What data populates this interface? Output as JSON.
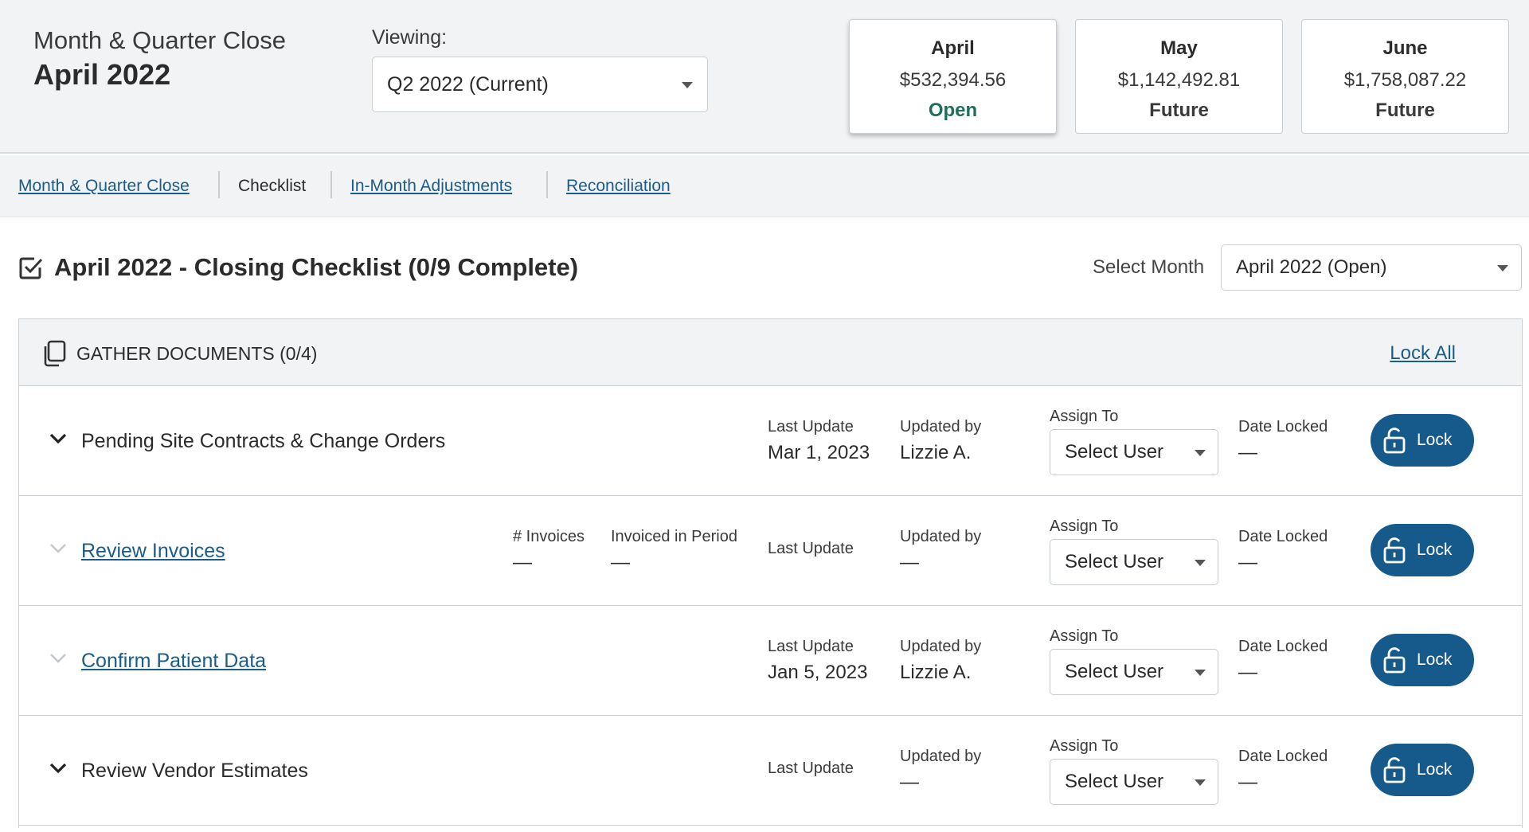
{
  "header": {
    "close_label": "Month & Quarter Close",
    "close_month": "April 2022",
    "viewing_label": "Viewing:",
    "viewing_value": "Q2 2022 (Current)",
    "months": [
      {
        "name": "April",
        "amount": "$532,394.56",
        "status": "Open"
      },
      {
        "name": "May",
        "amount": "$1,142,492.81",
        "status": "Future"
      },
      {
        "name": "June",
        "amount": "$1,758,087.22",
        "status": "Future"
      }
    ]
  },
  "tabs": [
    {
      "label": "Month & Quarter Close"
    },
    {
      "label": "Checklist"
    },
    {
      "label": "In-Month Adjustments"
    },
    {
      "label": "Reconciliation"
    }
  ],
  "checklist": {
    "title": "April 2022 - Closing Checklist (0/9 Complete)",
    "select_month_label": "Select Month",
    "select_month_value": "April 2022 (Open)"
  },
  "group": {
    "title": "GATHER DOCUMENTS (0/4)",
    "lock_all": "Lock All"
  },
  "labels": {
    "last_update": "Last Update",
    "updated_by": "Updated by",
    "assign_to": "Assign To",
    "date_locked": "Date Locked",
    "invoices": "# Invoices",
    "invoiced_in_period": "Invoiced in Period",
    "select_user": "Select User",
    "lock": "Lock"
  },
  "rows": [
    {
      "title": "Pending Site Contracts & Change Orders",
      "last_update": "Mar 1, 2023",
      "updated_by": "Lizzie A.",
      "date_locked": "—"
    },
    {
      "title": "Review Invoices",
      "invoices": "—",
      "invoiced_in_period": "—",
      "updated_by": "—",
      "date_locked": "—"
    },
    {
      "title": "Confirm Patient Data",
      "last_update": "Jan 5, 2023",
      "updated_by": "Lizzie A.",
      "date_locked": "—"
    },
    {
      "title": "Review Vendor Estimates",
      "updated_by": "—",
      "date_locked": "—"
    }
  ]
}
